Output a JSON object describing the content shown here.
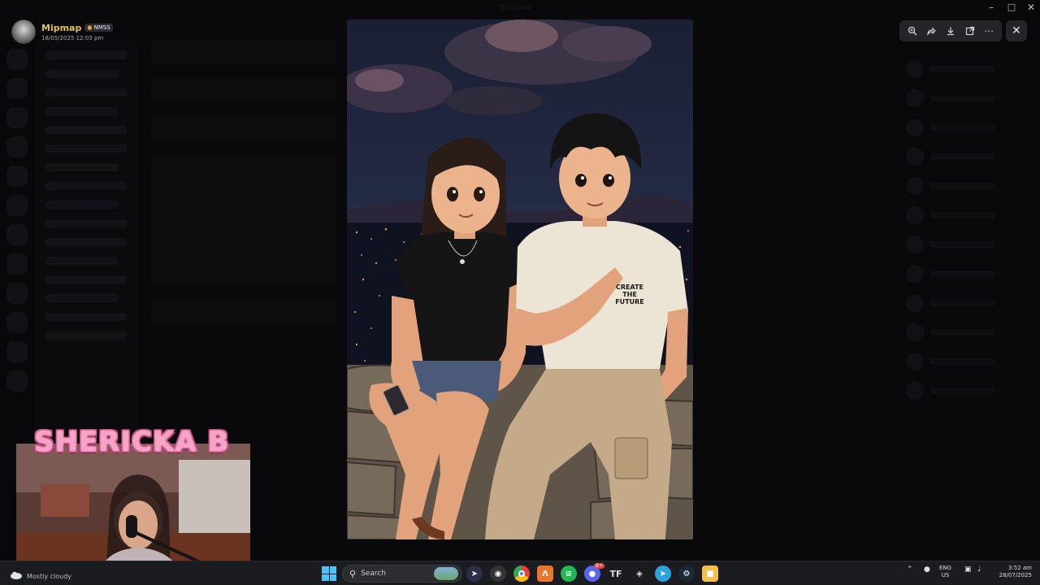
{
  "app": {
    "window_title": "Discord"
  },
  "poster": {
    "name": "Mipmap",
    "tag": "NMSS",
    "date": "18/05/2025 12:03 pm"
  },
  "image": {
    "shirt_text_1": "CREATE",
    "shirt_text_2": "THE",
    "shirt_text_3": "FUTURE"
  },
  "toolbar": {
    "zoom_icon": "zoom-in-icon",
    "forward_icon": "forward-icon",
    "download_icon": "download-icon",
    "open_icon": "open-external-icon",
    "more_icon": "more-icon",
    "close_icon": "close-icon"
  },
  "webcam": {
    "streamer_name": "SHERICKA B"
  },
  "taskbar": {
    "weather_text": "Mostly cloudy",
    "search_placeholder": "Search",
    "lang_line1": "ENG",
    "lang_line2": "US",
    "time": "3:52 am",
    "date": "28/07/2025",
    "discord_badge": "9+"
  },
  "colors": {
    "accent_gold": "#e7c156",
    "pink_title": "#f6a3c7",
    "start_blue": "#4cc2ff"
  }
}
